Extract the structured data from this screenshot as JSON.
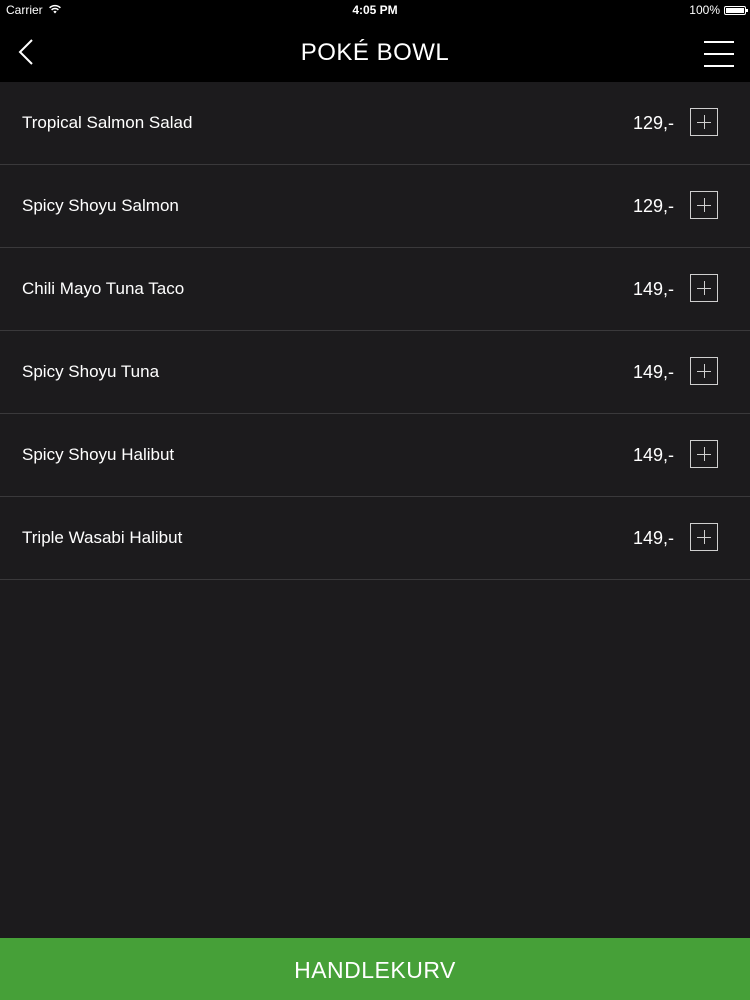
{
  "status_bar": {
    "carrier": "Carrier",
    "time": "4:05 PM",
    "battery": "100%",
    "battery_level": 1.0
  },
  "nav": {
    "back_icon": "chevron-left-icon",
    "title": "POKÉ BOWL",
    "menu_icon": "hamburger-menu-icon"
  },
  "menu": {
    "items": [
      {
        "name": "Tropical Salmon Salad",
        "price": "129,-"
      },
      {
        "name": "Spicy Shoyu Salmon",
        "price": "129,-"
      },
      {
        "name": "Chili Mayo Tuna Taco",
        "price": "149,-"
      },
      {
        "name": "Spicy Shoyu Tuna",
        "price": "149,-"
      },
      {
        "name": "Spicy Shoyu Halibut",
        "price": "149,-"
      },
      {
        "name": "Triple Wasabi Halibut",
        "price": "149,-"
      }
    ],
    "add_icon": "plus-icon"
  },
  "cart": {
    "label": "HANDLEKURV"
  },
  "colors": {
    "background": "#1c1b1d",
    "nav_background": "#000000",
    "cart_green": "#46a038",
    "divider": "#3a393b"
  }
}
